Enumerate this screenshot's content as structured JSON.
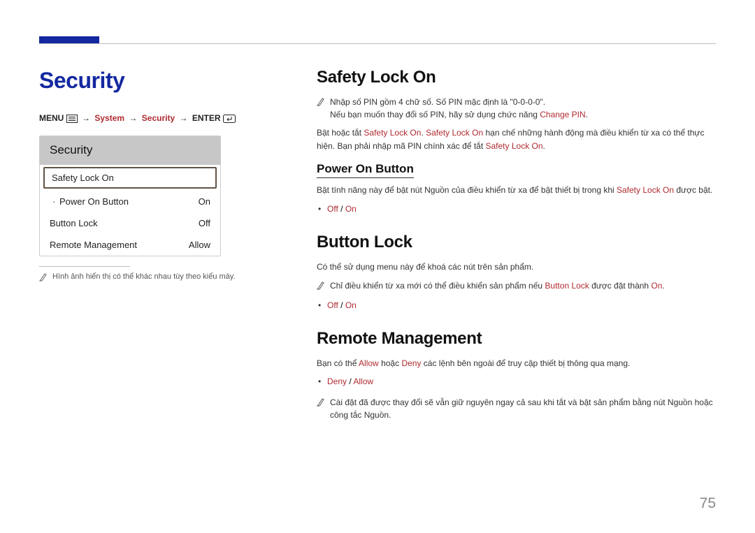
{
  "left": {
    "title": "Security",
    "breadcrumb": {
      "menu": "MENU",
      "system": "System",
      "security": "Security",
      "enter": "ENTER"
    },
    "menu": {
      "header": "Security",
      "row_safety": "Safety Lock On",
      "row_power_label": "Power On Button",
      "row_power_value": "On",
      "row_btnlock_label": "Button Lock",
      "row_btnlock_value": "Off",
      "row_remote_label": "Remote Management",
      "row_remote_value": "Allow"
    },
    "footnote": "Hình ảnh hiển thị có thể khác nhau tùy theo kiểu máy."
  },
  "right": {
    "safety_title": "Safety Lock On",
    "safety_note_1a": "Nhập số PIN gồm 4 chữ số. Số PIN mặc định là \"0-0-0-0\".",
    "safety_note_1b_pre": "Nếu bạn muốn thay đổi số PIN, hãy sử dụng chức năng ",
    "safety_note_1b_em": "Change PIN",
    "safety_note_1b_post": ".",
    "safety_p_1": "Bật hoặc tắt ",
    "safety_p_2": "Safety Lock On",
    "safety_p_3": ". ",
    "safety_p_4": "Safety Lock On",
    "safety_p_5": " hạn chế những hành động mà điều khiển từ xa có thể thực hiện. Bạn phải nhập mã PIN chính xác để tắt ",
    "safety_p_6": "Safety Lock On",
    "safety_p_7": ".",
    "power_sub": "Power On Button",
    "power_p_1": "Bật tính năng này để bật nút Nguồn của điều khiển từ xa để bật thiết bị trong khi ",
    "power_p_2": "Safety Lock On",
    "power_p_3": " được bật.",
    "off": "Off",
    "on": "On",
    "slash": " / ",
    "btnlock_title": "Button Lock",
    "btnlock_p": "Có thể sử dụng menu này để khoá các nút trên sản phẩm.",
    "btnlock_note_1": "Chỉ điều khiển từ xa mới có thể điều khiển sản phẩm nếu ",
    "btnlock_note_2": "Button Lock",
    "btnlock_note_3": " được đặt thành ",
    "btnlock_note_4": "On",
    "btnlock_note_5": ".",
    "remote_title": "Remote Management",
    "remote_p_1": "Bạn có thể ",
    "remote_p_allow": "Allow",
    "remote_p_2": " hoặc ",
    "remote_p_deny": "Deny",
    "remote_p_3": " các lệnh bên ngoài để truy cập thiết bị thông qua mạng.",
    "deny": "Deny",
    "allow": "Allow",
    "remote_note": "Cài đặt đã được thay đổi sẽ vẫn giữ nguyên ngay cả sau khi tắt và bật sản phẩm bằng nút Nguồn hoặc công tắc Nguồn."
  },
  "page_number": "75"
}
